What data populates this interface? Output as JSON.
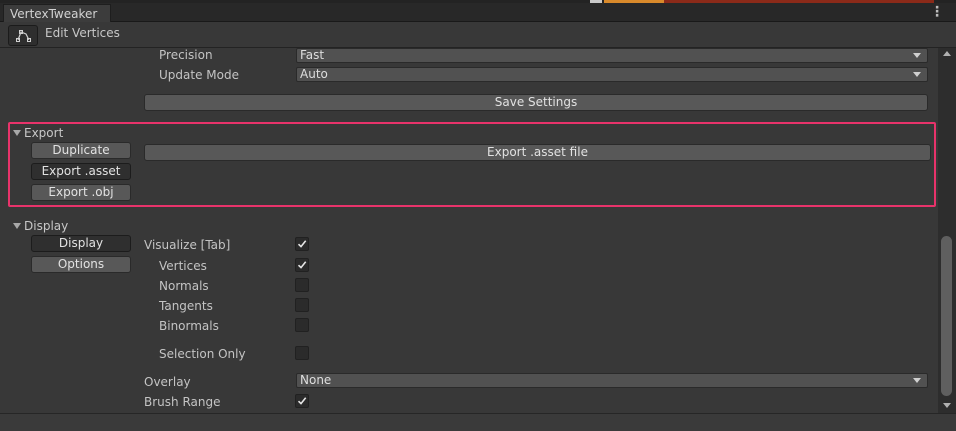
{
  "window": {
    "tab_title": "VertexTweaker",
    "menu_icon": "kebab-menu-icon"
  },
  "toolbar": {
    "tool_icon": "vertex-path-icon",
    "tool_label": "Edit Vertices"
  },
  "settings": {
    "precision_label": "Precision",
    "precision_value": "Fast",
    "update_mode_label": "Update Mode",
    "update_mode_value": "Auto",
    "save_button": "Save Settings"
  },
  "export": {
    "foldout_label": "Export",
    "tabs": [
      "Duplicate",
      "Export .asset",
      "Export .obj"
    ],
    "selected_tab": "Export .asset",
    "action_button": "Export .asset file"
  },
  "display": {
    "foldout_label": "Display",
    "tabs": [
      "Display",
      "Options"
    ],
    "selected_tab": "Display",
    "visualize_label": "Visualize [Tab]",
    "visualize_checked": true,
    "vertices_label": "Vertices",
    "vertices_checked": true,
    "normals_label": "Normals",
    "normals_checked": false,
    "tangents_label": "Tangents",
    "tangents_checked": false,
    "binormals_label": "Binormals",
    "binormals_checked": false,
    "selection_only_label": "Selection Only",
    "selection_only_checked": false,
    "overlay_label": "Overlay",
    "overlay_value": "None",
    "brush_range_label": "Brush Range",
    "brush_range_checked": true
  },
  "colors": {
    "panel_bg": "#383838",
    "highlight_border": "#e8336b",
    "dropdown_bg": "#515151",
    "button_bg": "#585858",
    "selected_button_bg": "#2f2f2f"
  }
}
